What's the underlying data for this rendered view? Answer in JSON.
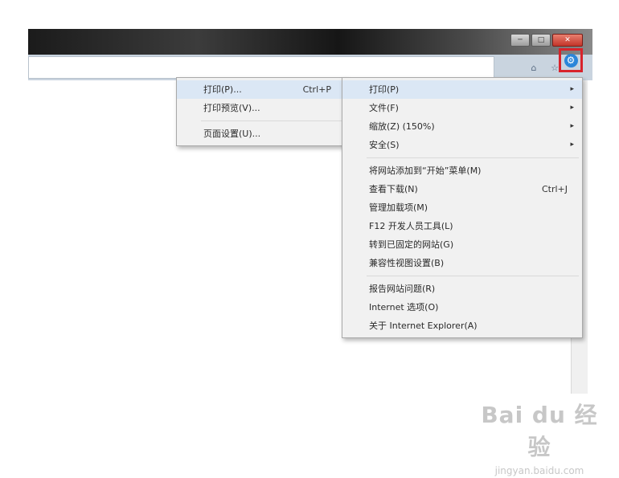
{
  "window": {
    "buttons": {
      "minimize": "─",
      "maximize": "□",
      "close": "✕"
    }
  },
  "toolbar": {
    "home_icon": "⌂",
    "favorites_icon": "☆",
    "tools_icon": "⚙"
  },
  "tools_menu": {
    "items": [
      {
        "label": "打印(P)",
        "arrow": "▸"
      },
      {
        "label": "文件(F)",
        "arrow": "▸"
      },
      {
        "label": "缩放(Z) (150%)",
        "arrow": "▸"
      },
      {
        "label": "安全(S)",
        "arrow": "▸"
      },
      {
        "label": "将网站添加到“开始”菜单(M)"
      },
      {
        "label": "查看下载(N)",
        "shortcut": "Ctrl+J"
      },
      {
        "label": "管理加载项(M)"
      },
      {
        "label": "F12 开发人员工具(L)"
      },
      {
        "label": "转到已固定的网站(G)"
      },
      {
        "label": "兼容性视图设置(B)"
      },
      {
        "label": "报告网站问题(R)"
      },
      {
        "label": "Internet 选项(O)"
      },
      {
        "label": "关于 Internet Explorer(A)"
      }
    ]
  },
  "print_submenu": {
    "items": [
      {
        "label": "打印(P)...",
        "shortcut": "Ctrl+P"
      },
      {
        "label": "打印预览(V)..."
      },
      {
        "label": "页面设置(U)..."
      }
    ]
  },
  "watermark": {
    "logo_text": "Bai du 经验",
    "url": "jingyan.baidu.com"
  },
  "colors": {
    "highlight_box": "#d8232b",
    "gear_blue": "#2b86d9",
    "menu_bg": "#f1f1f1",
    "menu_highlight": "#dbe7f5"
  }
}
